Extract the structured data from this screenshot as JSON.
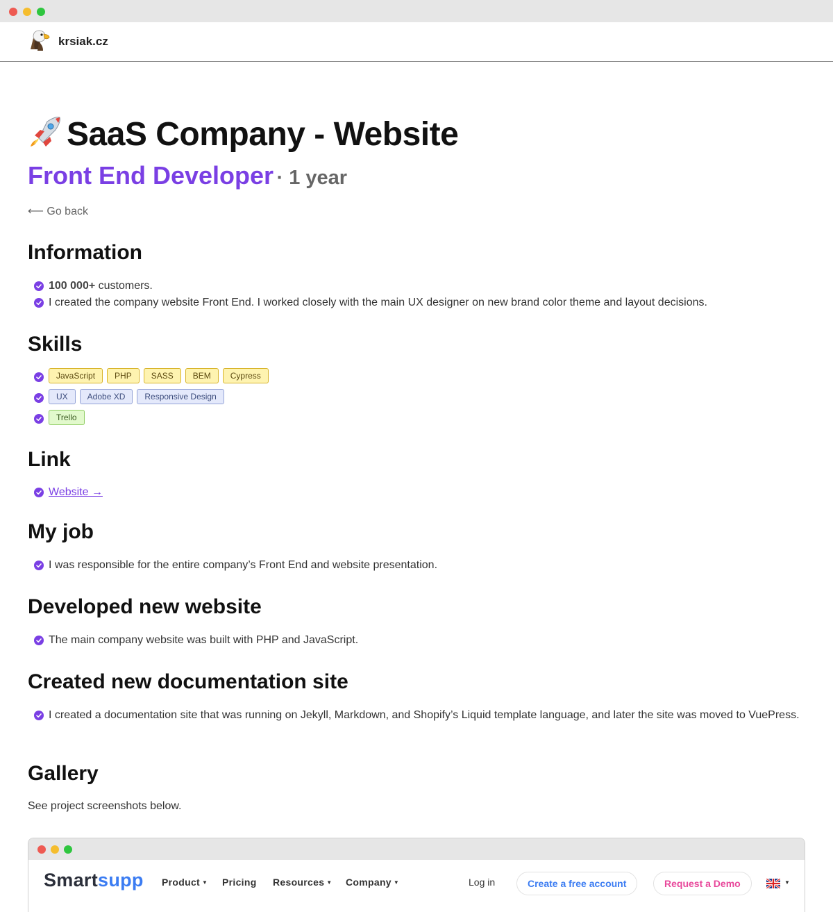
{
  "site": {
    "name": "krsiak.cz",
    "logo_icon": "eagle-icon"
  },
  "page": {
    "title": "SaaS Company - Website",
    "title_icon": "rocket-icon",
    "role": "Front End Developer",
    "duration": "· 1 year",
    "go_back": "⟵ Go back"
  },
  "sections": {
    "information": {
      "title": "Information",
      "item1_bold": "100 000+",
      "item1_rest": " customers.",
      "item2": "I created the company website Front End. I worked closely with the main UX designer on new brand color theme and layout decisions."
    },
    "skills": {
      "title": "Skills",
      "rows": [
        [
          "JavaScript",
          "PHP",
          "SASS",
          "BEM",
          "Cypress"
        ],
        [
          "UX",
          "Adobe XD",
          "Responsive Design"
        ],
        [
          "Trello"
        ]
      ]
    },
    "link": {
      "title": "Link",
      "website": "Website →"
    },
    "my_job": {
      "title": "My job",
      "item": "I was responsible for the entire company’s Front End and website presentation."
    },
    "developed": {
      "title": "Developed new website",
      "item": "The main company website was built with PHP and JavaScript."
    },
    "documentation": {
      "title": "Created new documentation site",
      "item": "I created a documentation site that was running on Jekyll, Markdown, and Shopify’s Liquid template language, and later the site was moved to VuePress."
    },
    "gallery": {
      "title": "Gallery",
      "intro": "See project screenshots below."
    }
  },
  "screenshot": {
    "logo_part1": "Smart",
    "logo_part2": "supp",
    "nav": {
      "product": "Product",
      "pricing": "Pricing",
      "resources": "Resources",
      "company": "Company"
    },
    "login": "Log in",
    "create_account": "Create a free account",
    "request_demo": "Request a Demo",
    "language_icon": "uk-flag-icon"
  },
  "colors": {
    "accent": "#7a3fe4",
    "smartsupp_blue": "#3b7cf2",
    "smartsupp_pink": "#e8489b"
  }
}
